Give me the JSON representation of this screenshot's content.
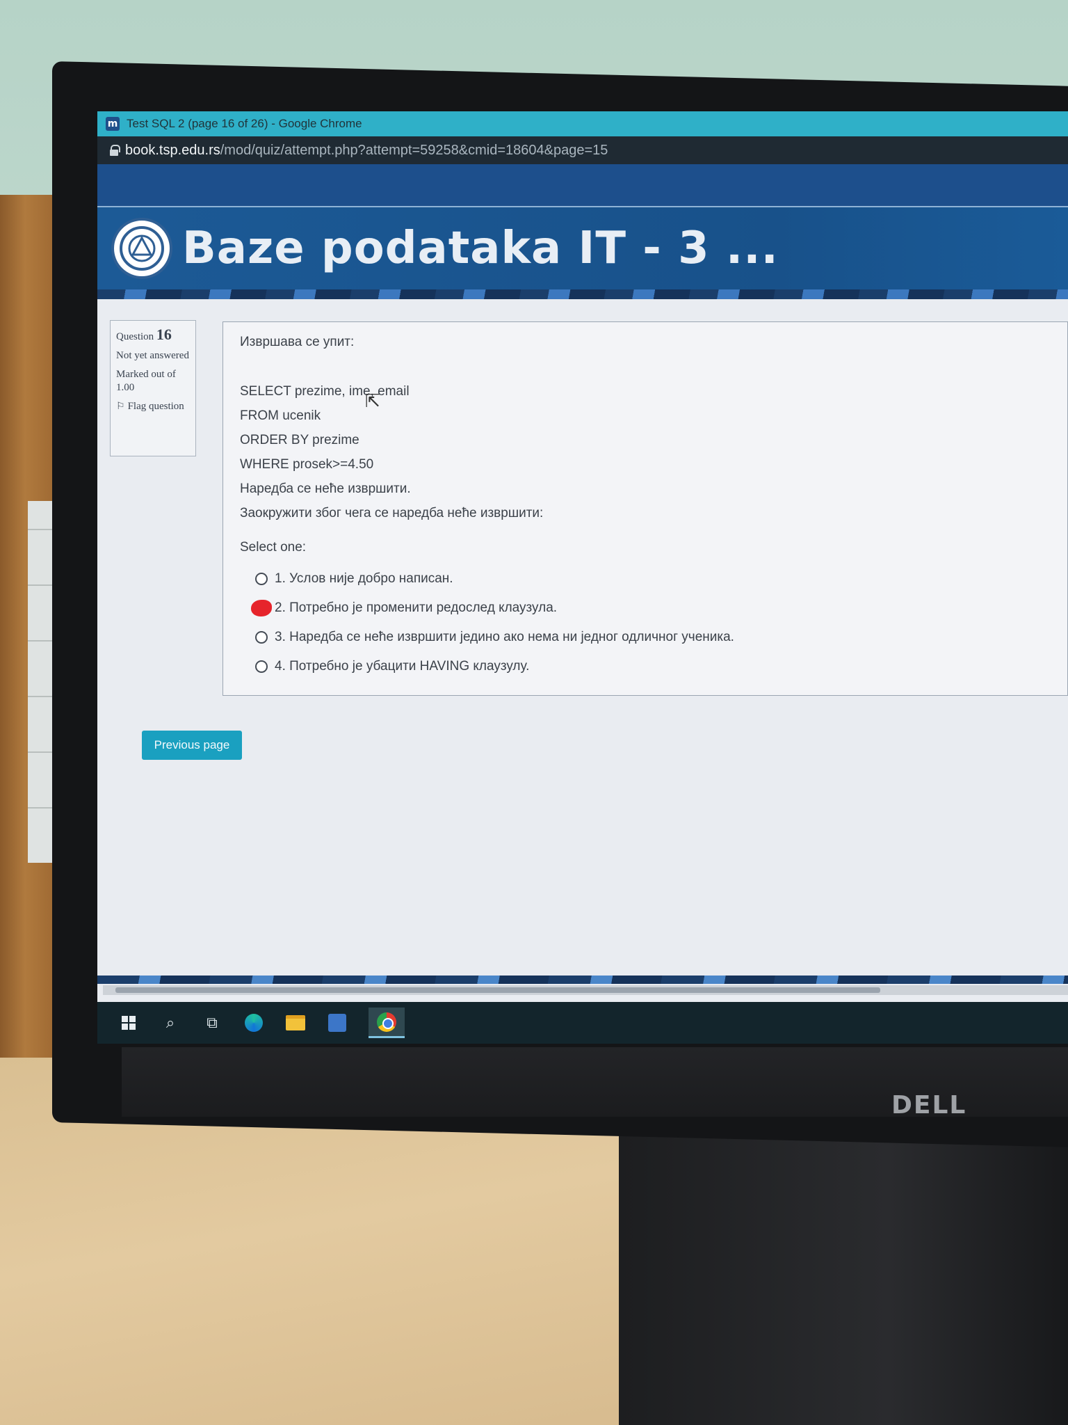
{
  "window": {
    "title": "Test SQL 2 (page 16 of 26) - Google Chrome",
    "app_icon": "moodle-icon"
  },
  "address_bar": {
    "domain": "book.tsp.edu.rs",
    "path": "/mod/quiz/attempt.php?attempt=59258&cmid=18604&page=15"
  },
  "banner": {
    "title": "Baze podataka IT - 3 ..."
  },
  "question_info": {
    "label": "Question",
    "number": "16",
    "status": "Not yet answered",
    "marked_out_of": "Marked out of 1.00",
    "flag_label": "Flag question"
  },
  "question": {
    "intro": "Извршава се упит:",
    "query_lines": [
      "SELECT prezime, ime, email",
      "FROM ucenik",
      "ORDER BY prezime",
      "WHERE prosek>=4.50"
    ],
    "statement": "Наредба се неће извршити.",
    "prompt": "Заокружити због чега се наредба неће извршити:",
    "select_label": "Select one:",
    "answers": [
      "1. Услов није добро написан.",
      "2. Потребно је променити редослед клаузула.",
      "3. Наредба се неће извршити једино ако нема ни једног одличног ученика.",
      "4. Потребно је убацити HAVING клаузулу."
    ],
    "marked_answer_index": 1
  },
  "navigation": {
    "previous_label": "Previous page"
  },
  "monitor": {
    "brand": "DELL"
  },
  "taskbar": {
    "icons": [
      "windows-start-icon",
      "search-icon",
      "task-view-icon",
      "edge-icon",
      "file-explorer-icon",
      "store-icon",
      "chrome-icon"
    ]
  },
  "colors": {
    "titlebar": "#2fb0c8",
    "banner": "#1c5a96",
    "button": "#1aa0c0",
    "mark": "#e6242b"
  }
}
